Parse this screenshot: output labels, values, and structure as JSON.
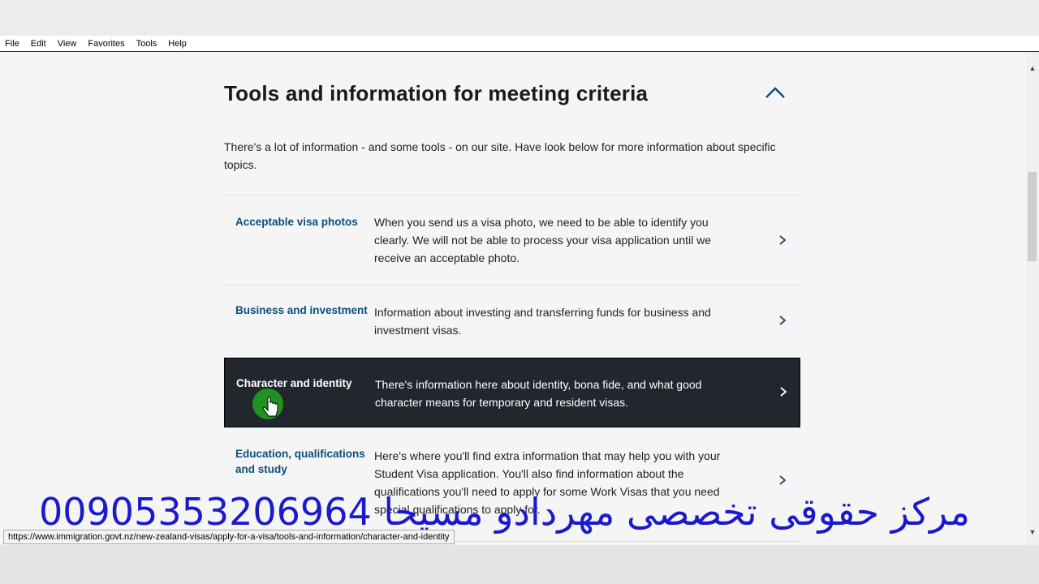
{
  "menu": [
    "File",
    "Edit",
    "View",
    "Favorites",
    "Tools",
    "Help"
  ],
  "section": {
    "title": "Tools and information for meeting criteria",
    "intro": "There's a lot of information - and some tools - on our site. Have look below for more information about specific topics."
  },
  "rows": [
    {
      "title": "Acceptable visa photos",
      "desc": "When you send us a visa photo, we need to be able to identify you clearly. We will not be able to process your visa application until we receive an acceptable photo."
    },
    {
      "title": "Business and investment",
      "desc": "Information about investing and transferring funds for business and investment visas."
    },
    {
      "title": "Character and identity",
      "desc": "There's information here about identity, bona fide, and what good character means for temporary and resident visas."
    },
    {
      "title": "Education, qualifications and study",
      "desc": "Here's where you'll find extra information that may help you with your Student Visa application. You'll also find information about the qualifications you'll need to apply for some Work Visas that you need special qualifications to apply for."
    }
  ],
  "status_url": "https://www.immigration.govt.nz/new-zealand-visas/apply-for-a-visa/tools-and-information/character-and-identity",
  "watermark": "مرکز حقوقی تخصصی مهردادو مسیحا 00905353206964",
  "colors": {
    "link": "#0b4f7c",
    "active_bg": "#22272e",
    "cursor_highlight": "#1fa01f",
    "watermark": "#1a1acc"
  },
  "icons": {
    "collapse": "chevron-up-icon",
    "row": "chevron-right-icon",
    "cursor": "hand-pointer-icon"
  }
}
